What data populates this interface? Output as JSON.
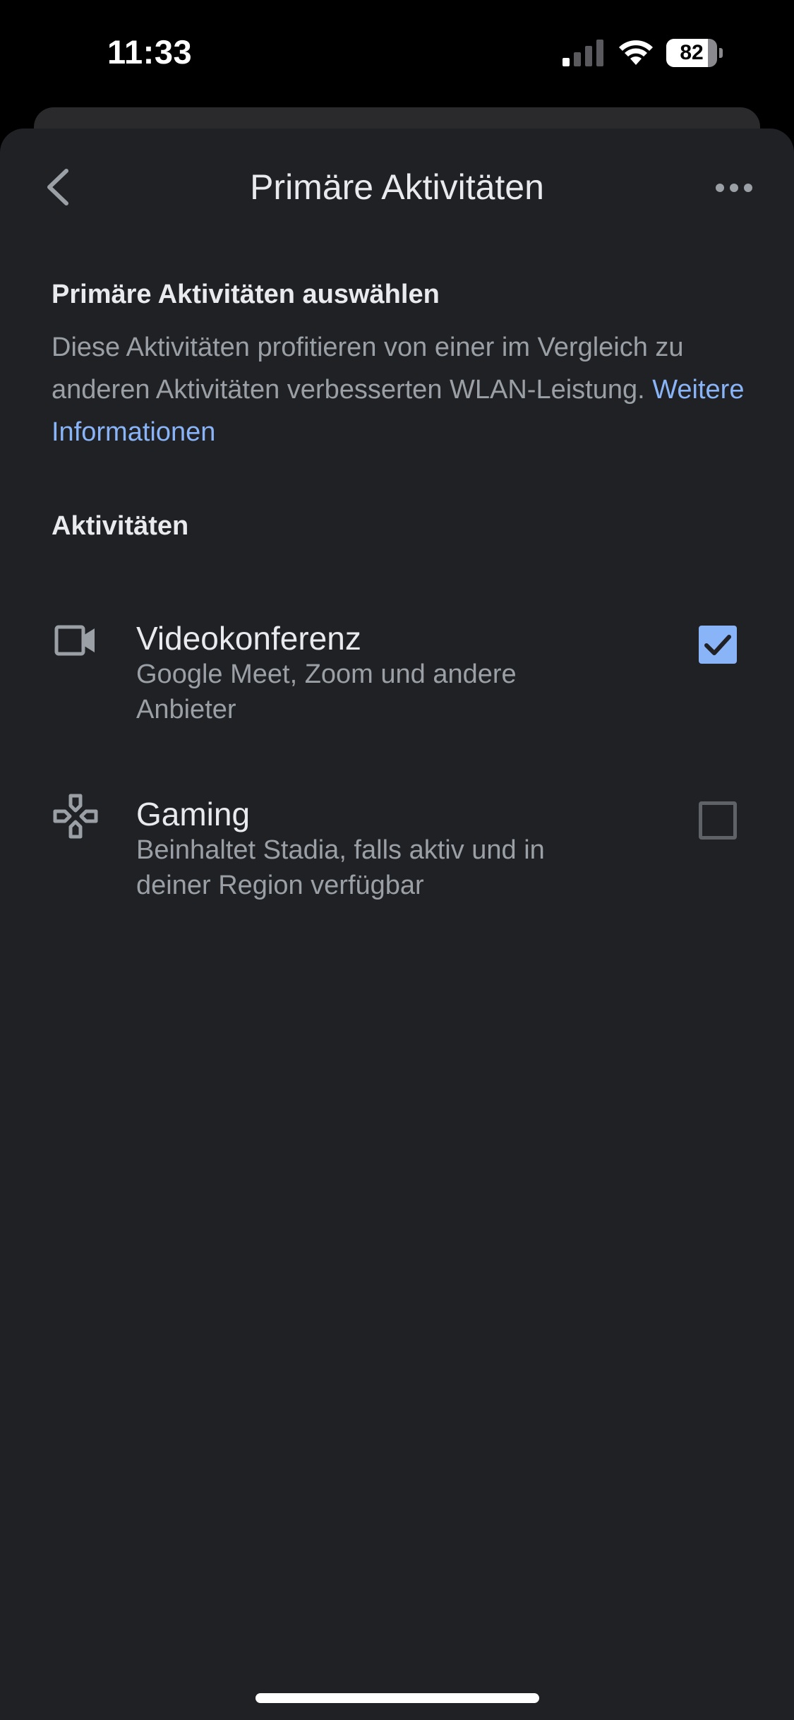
{
  "status_bar": {
    "time": "11:33",
    "battery_level": "82",
    "battery_fraction": 0.82
  },
  "header": {
    "title": "Primäre Aktivitäten",
    "back_icon": "chevron-left-icon",
    "more_icon": "more-horiz-icon"
  },
  "intro": {
    "heading": "Primäre Aktivitäten auswählen",
    "description": "Diese Aktivitäten profitieren von einer im Vergleich zu anderen Aktivitäten verbesserten WLAN-Leistung. ",
    "link_text": "Weitere Informationen"
  },
  "activities": {
    "heading": "Aktivitäten",
    "items": [
      {
        "title": "Videokonferenz",
        "subtitle": "Google Meet, Zoom und andere Anbieter",
        "icon": "videocam-icon",
        "checked": true
      },
      {
        "title": "Gaming",
        "subtitle": "Beinhaltet Stadia, falls aktiv und in deiner Region verfügbar",
        "icon": "gamepad-icon",
        "checked": false
      }
    ]
  },
  "colors": {
    "background": "#202124",
    "accent": "#8ab4f8",
    "text_primary": "#e8eaed",
    "text_secondary": "#9aa0a6"
  }
}
